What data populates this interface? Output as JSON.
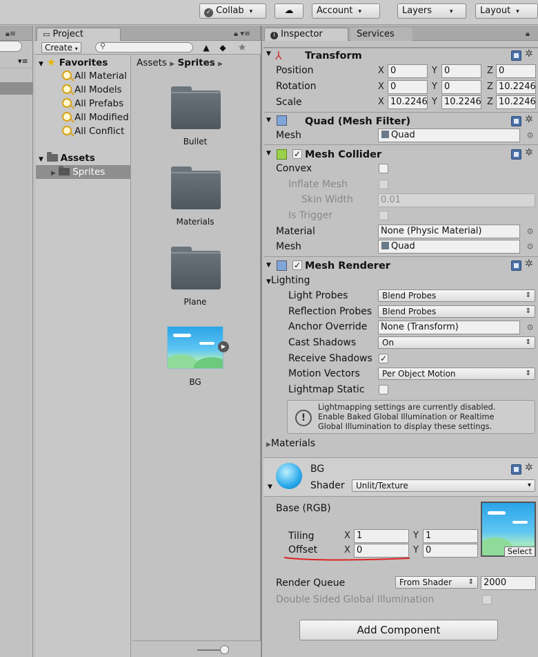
{
  "toolbar": {
    "collab": "Collab",
    "account": "Account",
    "layers": "Layers",
    "layout": "Layout"
  },
  "project": {
    "tab_label": "Project",
    "create_label": "Create",
    "favorites_label": "Favorites",
    "favorites": [
      "All Material",
      "All Models",
      "All Prefabs",
      "All Modified",
      "All Conflict"
    ],
    "assets_label": "Assets",
    "assets_children": [
      "Sprites"
    ],
    "breadcrumb": [
      "Assets",
      "Sprites"
    ],
    "items": [
      {
        "name": "Bullet",
        "icon": "folder-icon"
      },
      {
        "name": "Materials",
        "icon": "folder-icon"
      },
      {
        "name": "Plane",
        "icon": "folder-icon"
      },
      {
        "name": "BG",
        "icon": "sky-texture-icon"
      }
    ]
  },
  "inspector": {
    "tab_label": "Inspector",
    "services_label": "Services",
    "transform": {
      "title": "Transform",
      "position_label": "Position",
      "rotation_label": "Rotation",
      "scale_label": "Scale",
      "axes": [
        "X",
        "Y",
        "Z"
      ],
      "position": [
        "0",
        "0",
        "0"
      ],
      "rotation": [
        "0",
        "0",
        "10.2246"
      ],
      "scale": [
        "10.2246",
        "10.2246",
        "10.2246"
      ]
    },
    "mesh_filter": {
      "title": "Quad (Mesh Filter)",
      "mesh_label": "Mesh",
      "mesh_value": "Quad"
    },
    "mesh_collider": {
      "title": "Mesh Collider",
      "enabled": true,
      "convex_label": "Convex",
      "inflate_label": "Inflate Mesh",
      "skin_label": "Skin Width",
      "skin_value": "0.01",
      "trigger_label": "Is Trigger",
      "material_label": "Material",
      "material_value": "None (Physic Material)",
      "mesh_label": "Mesh",
      "mesh_value": "Quad"
    },
    "mesh_renderer": {
      "title": "Mesh Renderer",
      "enabled": true,
      "lighting_label": "Lighting",
      "light_probes_label": "Light Probes",
      "light_probes_value": "Blend Probes",
      "reflection_label": "Reflection Probes",
      "reflection_value": "Blend Probes",
      "anchor_label": "Anchor Override",
      "anchor_value": "None (Transform)",
      "cast_label": "Cast Shadows",
      "cast_value": "On",
      "receive_label": "Receive Shadows",
      "receive_checked": true,
      "motion_label": "Motion Vectors",
      "motion_value": "Per Object Motion",
      "static_label": "Lightmap Static",
      "info_text": "Lightmapping settings are currently disabled. Enable Baked Global Illumination or Realtime Global Illumination to display these settings.",
      "materials_label": "Materials"
    },
    "material": {
      "name": "BG",
      "shader_label": "Shader",
      "shader_value": "Unlit/Texture",
      "base_label": "Base (RGB)",
      "tiling_label": "Tiling",
      "offset_label": "Offset",
      "tiling": [
        "1",
        "1"
      ],
      "offset": [
        "0",
        "0"
      ],
      "axes": [
        "X",
        "Y"
      ],
      "select_label": "Select",
      "render_queue_label": "Render Queue",
      "render_queue_mode": "From Shader",
      "render_queue_value": "2000",
      "dsgi_label": "Double Sided Global Illumination",
      "annotation_color": "#e02020"
    },
    "add_component_label": "Add Component"
  }
}
